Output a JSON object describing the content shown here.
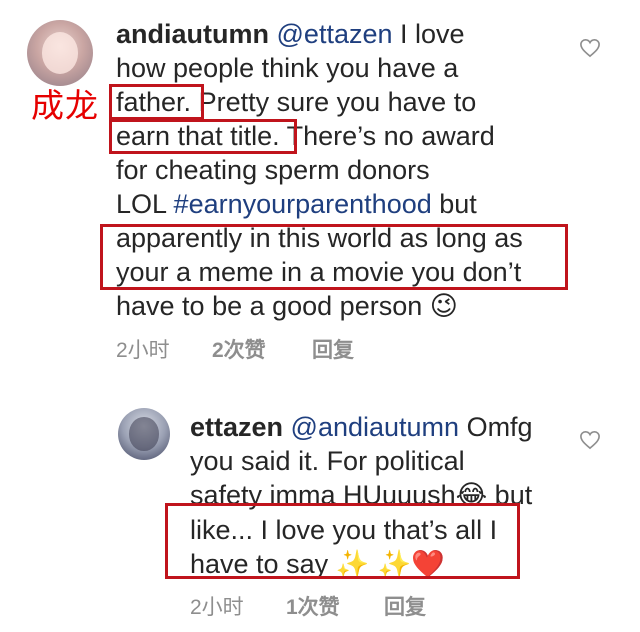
{
  "overlay": {
    "text": "成龙"
  },
  "main_comment": {
    "username": "andiautumn",
    "mention": "@ettazen",
    "line1_rest": " I love",
    "line2": "how people think you have a",
    "line3_a": "father.",
    "line3_b": " Pretty sure you have to",
    "line4_a": "earn that title.",
    "line4_b": " There’s no award",
    "line5": "for cheating sperm donors",
    "line6_a": "LOL ",
    "hashtag": "#earnyourparenthood",
    "line6_b": " but",
    "line7": "apparently in this world as long as",
    "line8": "your a meme in a movie you don’t",
    "line9": "have to be a good person ",
    "emoji": "😉",
    "time": "2小时",
    "likes": "2次赞",
    "reply_label": "回复"
  },
  "reply_comment": {
    "username": "ettazen",
    "mention": "@andiautumn",
    "line1_rest": " Omfg",
    "line2": "you said it. For political",
    "line3": "safety imma HUuuush",
    "line3_emoji": "😂",
    "line3_b": " but",
    "line4": "like... I love you that’s all I",
    "line5": "have to say ",
    "line5_emoji": "✨ ✨❤️",
    "time": "2小时",
    "likes": "1次赞",
    "reply_label": "回复"
  },
  "colors": {
    "highlight_box": "#c0141c",
    "overlay_text": "#e60000",
    "link": "#1f3f7f",
    "meta": "#8e8e8e"
  }
}
